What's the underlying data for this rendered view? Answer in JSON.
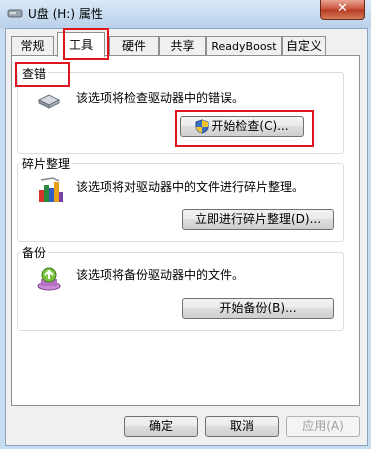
{
  "window": {
    "title": "U盘 (H:) 属性",
    "close_label": "✕"
  },
  "tabs": [
    {
      "label": "常规"
    },
    {
      "label": "工具"
    },
    {
      "label": "硬件"
    },
    {
      "label": "共享"
    },
    {
      "label": "ReadyBoost"
    },
    {
      "label": "自定义"
    }
  ],
  "error_check": {
    "title": "查错",
    "description": "该选项将检查驱动器中的错误。",
    "button_label": "开始检查(C)..."
  },
  "defrag": {
    "title": "碎片整理",
    "description": "该选项将对驱动器中的文件进行碎片整理。",
    "button_label": "立即进行碎片整理(D)..."
  },
  "backup": {
    "title": "备份",
    "description": "该选项将备份驱动器中的文件。",
    "button_label": "开始备份(B)..."
  },
  "footer": {
    "ok_label": "确定",
    "cancel_label": "取消",
    "apply_label": "应用(A)"
  },
  "colors": {
    "highlight_box": "#e0141e"
  },
  "icons": [
    "drive-icon",
    "shield-icon",
    "defrag-icon",
    "backup-icon",
    "close-icon"
  ]
}
